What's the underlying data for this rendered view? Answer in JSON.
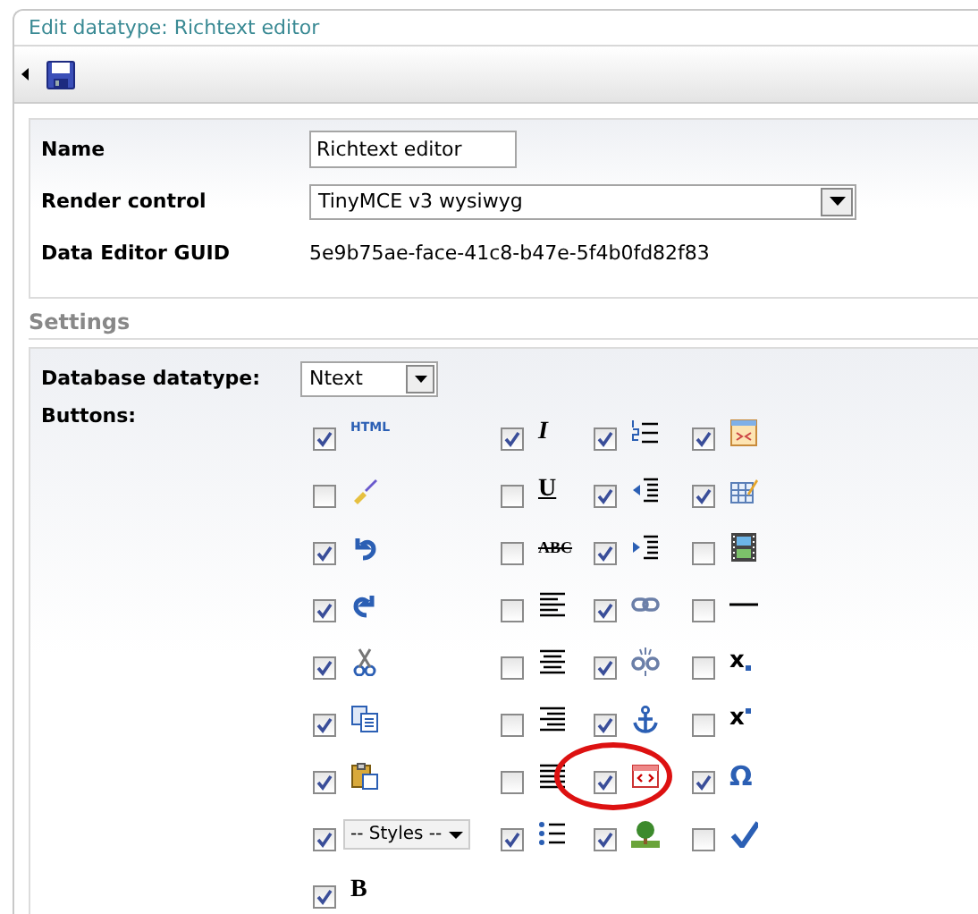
{
  "window": {
    "title": "Edit datatype: Richtext editor"
  },
  "properties": [
    {
      "label": "Name",
      "kind": "input",
      "value": "Richtext editor"
    },
    {
      "label": "Render control",
      "kind": "select",
      "value": "TinyMCE v3 wysiwyg"
    },
    {
      "label": "Data Editor GUID",
      "kind": "text",
      "value": "5e9b75ae-face-41c8-b47e-5f4b0fd82f83"
    }
  ],
  "settings": {
    "heading": "Settings",
    "database_label": "Database datatype:",
    "database_value": "Ntext",
    "buttons_label": "Buttons:",
    "buttons": [
      [
        {
          "kind": "html",
          "glyph": "HTML",
          "checked": true
        },
        {
          "kind": "italic",
          "glyph": "I",
          "checked": true
        },
        {
          "kind": "numlist",
          "checked": true
        },
        {
          "kind": "insert",
          "checked": true
        }
      ],
      [
        {
          "kind": "brush",
          "checked": false
        },
        {
          "kind": "underline",
          "glyph": "U",
          "checked": false
        },
        {
          "kind": "outdent",
          "checked": true
        },
        {
          "kind": "table",
          "checked": true
        }
      ],
      [
        {
          "kind": "undo",
          "checked": true
        },
        {
          "kind": "strike",
          "glyph": "ABC",
          "checked": false
        },
        {
          "kind": "indent",
          "checked": true
        },
        {
          "kind": "film",
          "checked": false
        }
      ],
      [
        {
          "kind": "redo",
          "checked": true
        },
        {
          "kind": "alignleft",
          "checked": false
        },
        {
          "kind": "link",
          "checked": true
        },
        {
          "kind": "hr",
          "checked": false
        }
      ],
      [
        {
          "kind": "cut",
          "checked": true
        },
        {
          "kind": "aligncenter",
          "checked": false
        },
        {
          "kind": "unlink",
          "checked": true
        },
        {
          "kind": "sub",
          "glyph": "x",
          "checked": false
        }
      ],
      [
        {
          "kind": "copy",
          "checked": true
        },
        {
          "kind": "alignright",
          "checked": false
        },
        {
          "kind": "anchor",
          "checked": true
        },
        {
          "kind": "sup",
          "glyph": "x",
          "checked": false
        }
      ],
      [
        {
          "kind": "paste",
          "checked": true
        },
        {
          "kind": "justify",
          "checked": false
        },
        {
          "kind": "code",
          "checked": true,
          "circled": true
        },
        {
          "kind": "omega",
          "glyph": "Ω",
          "checked": true
        }
      ],
      [
        {
          "kind": "select",
          "label": "-- Styles --",
          "checked": true
        },
        {
          "kind": "bullist",
          "checked": true
        },
        {
          "kind": "image",
          "checked": true
        },
        {
          "kind": "spell",
          "checked": false
        }
      ],
      [
        {
          "kind": "bold",
          "glyph": "B",
          "checked": true
        }
      ]
    ]
  }
}
